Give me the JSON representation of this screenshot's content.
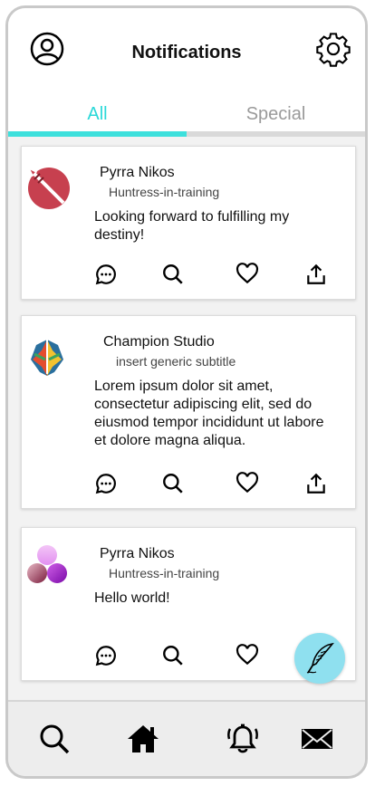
{
  "header": {
    "title": "Notifications"
  },
  "tabs": [
    {
      "label": "All"
    },
    {
      "label": "Special"
    }
  ],
  "posts": [
    {
      "name": "Pyrra Nikos",
      "subtitle": "Huntress-in-training",
      "text": "Looking forward to fulfilling my destiny!"
    },
    {
      "name": "Champion Studio",
      "subtitle": "insert generic subtitle",
      "text": "Lorem ipsum dolor sit amet, consectetur adipiscing elit, sed do eiusmod tempor incididunt ut labore et dolore magna aliqua."
    },
    {
      "name": "Pyrra Nikos",
      "subtitle": "Huntress-in-training",
      "text": "Hello world!"
    }
  ],
  "colors": {
    "accent": "#3de0dc",
    "fab": "#8fe0ef"
  },
  "icons": {
    "header": [
      "profile-icon",
      "gear-icon"
    ],
    "post_actions": [
      "comment-icon",
      "search-icon",
      "heart-icon",
      "share-icon"
    ],
    "fab": "quill-icon",
    "nav": [
      "search-icon",
      "home-icon",
      "bell-icon",
      "mail-icon"
    ]
  }
}
